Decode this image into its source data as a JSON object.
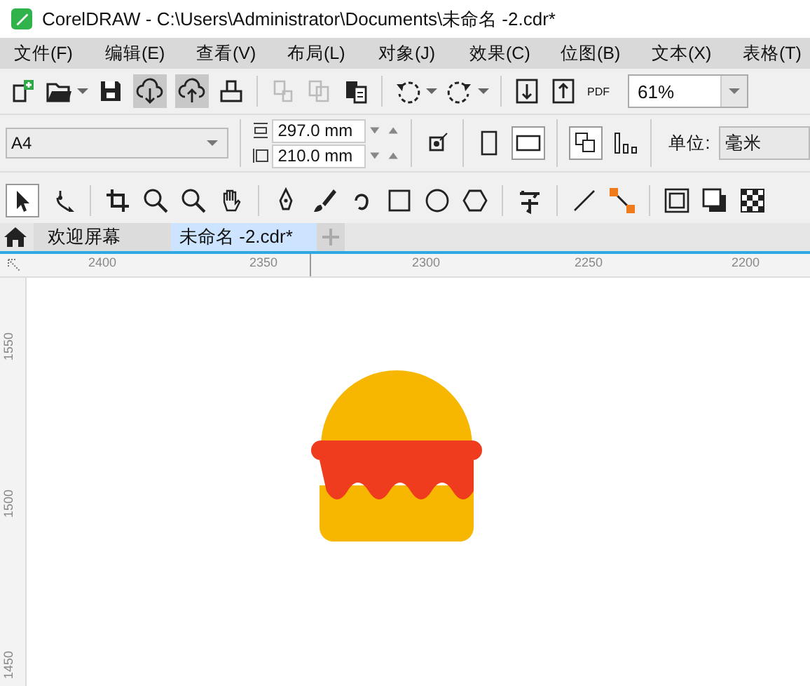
{
  "window": {
    "title": "CorelDRAW - C:\\Users\\Administrator\\Documents\\未命名 -2.cdr*"
  },
  "menu": [
    "文件(F)",
    "编辑(E)",
    "查看(V)",
    "布局(L)",
    "对象(J)",
    "效果(C)",
    "位图(B)",
    "文本(X)",
    "表格(T)"
  ],
  "standard_toolbar": {
    "pdf_label": "PDF",
    "zoom": "61%"
  },
  "property_bar": {
    "page_size": "A4",
    "width": "297.0 mm",
    "height": "210.0 mm",
    "unit_label": "单位:",
    "unit": "毫米"
  },
  "tabs": [
    {
      "label": "欢迎屏幕",
      "selected": false
    },
    {
      "label": "未命名 -2.cdr*",
      "selected": true
    }
  ],
  "ruler": {
    "horizontal": [
      "2400",
      "2350",
      "2300",
      "2250",
      "2200"
    ],
    "vertical": [
      "1550",
      "1500",
      "1450"
    ]
  }
}
